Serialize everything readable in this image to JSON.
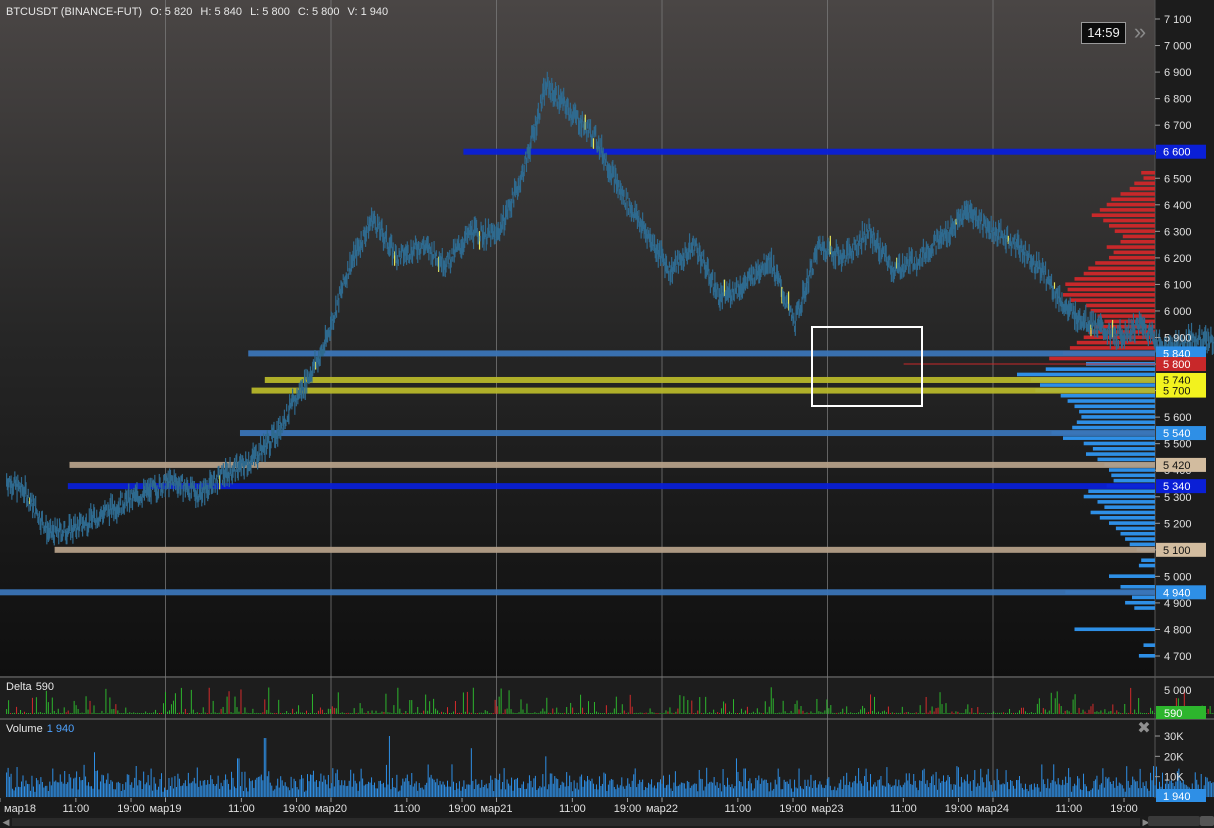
{
  "header": {
    "symbol": "BTCUSDT (BINANCE-FUT)",
    "open": "O: 5 820",
    "high": "H: 5 840",
    "low": "L: 5 800",
    "close": "C: 5 800",
    "volume": "V: 1 940"
  },
  "timer": "14:59",
  "icons": {
    "forward": "double-chevron-right-icon",
    "close": "close-icon",
    "scroll_left": "triangle-left-icon",
    "scroll_right": "triangle-right-icon"
  },
  "colors": {
    "background_top": "#4a4645",
    "background_bottom": "#0f0f0f",
    "candle": "#2f6a8f",
    "highlight_candle": "#e8e85a",
    "grid": "#7b7b7b",
    "dark_blue_level": "#0a1fd6",
    "steel_blue_level": "#3a74b6",
    "yellow_level": "#b7b72a",
    "tan_level": "#b49f88",
    "profile_sell": "#c8282a",
    "profile_buy": "#2e8fe6",
    "delta_pos": "#2db52d",
    "delta_neg": "#d22b2b",
    "volume_bar": "#2e8fe6"
  },
  "chart_data": {
    "type": "candlestick",
    "price_axis": {
      "ticks": [
        "7 100",
        "7 000",
        "6 900",
        "6 800",
        "6 700",
        "6 600",
        "6 500",
        "6 400",
        "6 300",
        "6 200",
        "6 100",
        "6 000",
        "5 900",
        "5 800",
        "5 700",
        "5 600",
        "5 500",
        "5 400",
        "5 300",
        "5 200",
        "5 100",
        "5 000",
        "4 900",
        "4 800",
        "4 700"
      ],
      "ylim": [
        4650,
        7150
      ]
    },
    "time_axis": {
      "labels": [
        "мар18",
        "11:00",
        "19:00",
        "мар19",
        "11:00",
        "19:00",
        "мар20",
        "11:00",
        "19:00",
        "мар21",
        "11:00",
        "19:00",
        "мар22",
        "11:00",
        "19:00",
        "мар23",
        "11:00",
        "19:00",
        "мар24",
        "11:00",
        "19:00"
      ]
    },
    "price_path": [
      [
        0,
        5380
      ],
      [
        0.15,
        5320
      ],
      [
        0.3,
        5160
      ],
      [
        0.45,
        5180
      ],
      [
        0.6,
        5230
      ],
      [
        0.75,
        5280
      ],
      [
        0.9,
        5320
      ],
      [
        1.05,
        5360
      ],
      [
        1.2,
        5310
      ],
      [
        1.35,
        5380
      ],
      [
        1.5,
        5430
      ],
      [
        1.65,
        5520
      ],
      [
        1.8,
        5680
      ],
      [
        1.95,
        5850
      ],
      [
        2.1,
        6150
      ],
      [
        2.25,
        6350
      ],
      [
        2.4,
        6200
      ],
      [
        2.55,
        6250
      ],
      [
        2.7,
        6180
      ],
      [
        2.85,
        6300
      ],
      [
        3.0,
        6280
      ],
      [
        3.15,
        6500
      ],
      [
        3.3,
        6850
      ],
      [
        3.45,
        6750
      ],
      [
        3.6,
        6650
      ],
      [
        3.75,
        6450
      ],
      [
        3.9,
        6300
      ],
      [
        4.05,
        6150
      ],
      [
        4.2,
        6250
      ],
      [
        4.35,
        6050
      ],
      [
        4.5,
        6100
      ],
      [
        4.65,
        6200
      ],
      [
        4.8,
        5950
      ],
      [
        4.95,
        6250
      ],
      [
        5.1,
        6200
      ],
      [
        5.25,
        6300
      ],
      [
        5.4,
        6150
      ],
      [
        5.55,
        6200
      ],
      [
        5.7,
        6280
      ],
      [
        5.85,
        6380
      ],
      [
        6.0,
        6300
      ],
      [
        6.15,
        6250
      ],
      [
        6.3,
        6150
      ],
      [
        6.45,
        6000
      ],
      [
        6.6,
        5950
      ],
      [
        6.75,
        5900
      ],
      [
        6.9,
        5950
      ],
      [
        7.05,
        5850
      ],
      [
        7.2,
        5900
      ],
      [
        7.35,
        5880
      ],
      [
        7.5,
        5900
      ],
      [
        7.65,
        5870
      ],
      [
        7.8,
        5840
      ],
      [
        7.95,
        5800
      ]
    ],
    "levels": [
      {
        "label": "6 600",
        "price": 6600,
        "start": 2.8,
        "color": "#0a1fd6",
        "tag_bg": "#0a1fd6",
        "tag_fg": "#ffffff"
      },
      {
        "label": "5 840",
        "price": 5840,
        "start": 1.5,
        "color": "#3a74b6",
        "tag_bg": "#2e8fe6",
        "tag_fg": "#ffffff"
      },
      {
        "label": "5 740",
        "price": 5740,
        "start": 1.6,
        "color": "#b7b72a",
        "tag_bg": "#f2f21e",
        "tag_fg": "#111111"
      },
      {
        "label": "5 700",
        "price": 5700,
        "start": 1.52,
        "color": "#b7b72a",
        "tag_bg": "#f2f21e",
        "tag_fg": "#111111"
      },
      {
        "label": "5 540",
        "price": 5540,
        "start": 1.45,
        "color": "#3a74b6",
        "tag_bg": "#2e8fe6",
        "tag_fg": "#ffffff"
      },
      {
        "label": "5 420",
        "price": 5420,
        "start": 0.42,
        "color": "#b49f88",
        "tag_bg": "#d2bc9f",
        "tag_fg": "#111111"
      },
      {
        "label": "5 340",
        "price": 5340,
        "start": 0.41,
        "color": "#0a1fd6",
        "tag_bg": "#0a1fd6",
        "tag_fg": "#ffffff"
      },
      {
        "label": "5 100",
        "price": 5100,
        "start": 0.33,
        "color": "#b49f88",
        "tag_bg": "#d2bc9f",
        "tag_fg": "#111111"
      },
      {
        "label": "4 940",
        "price": 4940,
        "start": 0,
        "color": "#3a74b6",
        "tag_bg": "#2e8fe6",
        "tag_fg": "#ffffff"
      }
    ],
    "last_price": {
      "label": "5 800",
      "price": 5800,
      "tag_bg": "#c8282a",
      "tag_fg": "#ffffff"
    },
    "volume_profile": {
      "sell_prices": [
        6520,
        6500,
        6480,
        6460,
        6440,
        6420,
        6400,
        6380,
        6360,
        6340,
        6320,
        6300,
        6280,
        6260,
        6240,
        6220,
        6200,
        6180,
        6160,
        6140,
        6120,
        6100,
        6080,
        6060,
        6040,
        6020,
        6000,
        5980,
        5960,
        5940,
        5920,
        5900,
        5880,
        5860,
        5840,
        5820
      ],
      "sell_values": [
        12,
        10,
        18,
        22,
        30,
        38,
        42,
        48,
        55,
        45,
        40,
        35,
        28,
        30,
        42,
        36,
        40,
        52,
        58,
        62,
        70,
        78,
        76,
        80,
        74,
        60,
        56,
        50,
        44,
        52,
        58,
        62,
        68,
        74,
        80,
        92
      ],
      "buy_prices": [
        5800,
        5780,
        5760,
        5740,
        5720,
        5700,
        5680,
        5660,
        5640,
        5620,
        5600,
        5580,
        5560,
        5540,
        5520,
        5500,
        5480,
        5460,
        5440,
        5420,
        5400,
        5380,
        5360,
        5340,
        5320,
        5300,
        5280,
        5260,
        5240,
        5220,
        5200,
        5180,
        5160,
        5140,
        5120,
        5100,
        5060,
        5040,
        5000,
        4960,
        4940,
        4920,
        4900,
        4880,
        4800,
        4740,
        4700
      ],
      "buy_values": [
        60,
        95,
        120,
        108,
        100,
        104,
        82,
        76,
        70,
        66,
        64,
        68,
        72,
        90,
        80,
        62,
        54,
        60,
        50,
        44,
        40,
        38,
        36,
        42,
        58,
        62,
        50,
        44,
        56,
        48,
        40,
        34,
        30,
        26,
        22,
        16,
        12,
        14,
        40,
        30,
        78,
        20,
        26,
        18,
        70,
        10,
        14
      ]
    },
    "delta": {
      "value": "590",
      "axis_tick": "5 000"
    },
    "volume": {
      "value": "1 940",
      "axis_ticks": [
        "30K",
        "20K",
        "10K"
      ],
      "last_label": "1 940"
    }
  }
}
